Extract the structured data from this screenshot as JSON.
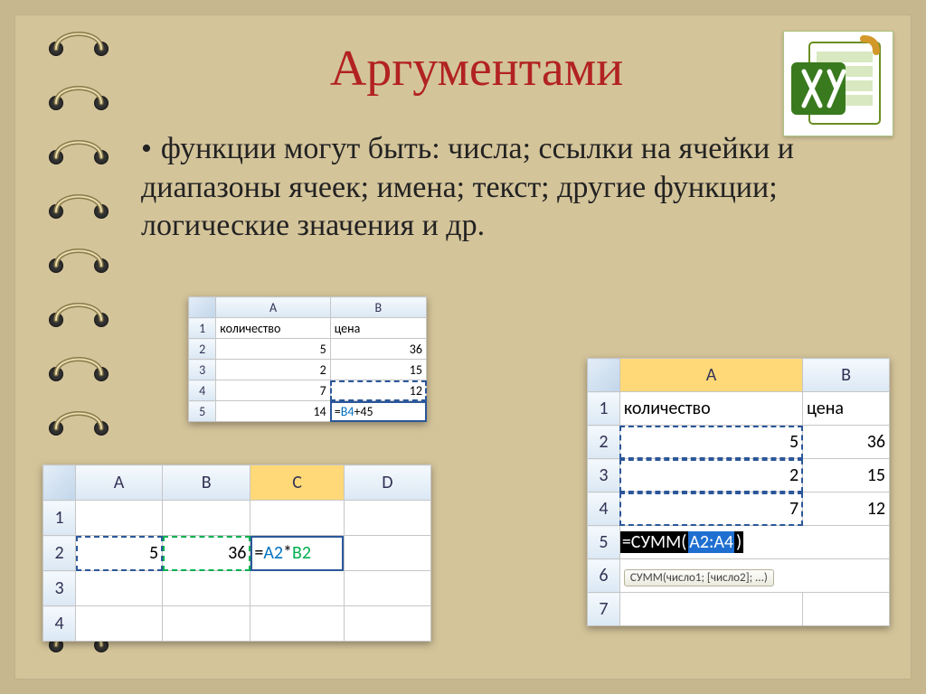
{
  "title": "Аргументами",
  "bullet_text": "функции могут быть: числа; ссылки на ячейки и диапазоны ячеек; имена; текст; другие функции; логические значения и др.",
  "icon_alt": "excel-icon",
  "shot1": {
    "cols": [
      "A",
      "B"
    ],
    "rows": [
      "1",
      "2",
      "3",
      "4",
      "5"
    ],
    "header": {
      "A": "количество",
      "B": "цена"
    },
    "data": {
      "A2": "5",
      "B2": "36",
      "A3": "2",
      "B3": "15",
      "A4": "7",
      "B4": "12",
      "A5": "14"
    },
    "formula": {
      "eq": "=",
      "ref": "B4",
      "rest": "+45"
    }
  },
  "shot2": {
    "cols": [
      "A",
      "B",
      "C",
      "D"
    ],
    "rows": [
      "1",
      "2",
      "3",
      "4"
    ],
    "data": {
      "A2": "5",
      "B2": "36"
    },
    "formula": {
      "eq": "=",
      "ref1": "A2",
      "op": "*",
      "ref2": "B2"
    }
  },
  "shot3": {
    "cols": [
      "A",
      "B"
    ],
    "rows": [
      "1",
      "2",
      "3",
      "4",
      "5",
      "6",
      "7"
    ],
    "header": {
      "A": "количество",
      "B": "цена"
    },
    "data": {
      "A2": "5",
      "B2": "36",
      "A3": "2",
      "B3": "15",
      "A4": "7",
      "B4": "12"
    },
    "formula_prefix": "=СУММ(",
    "formula_range": "A2:A4",
    "formula_suffix": ")",
    "tooltip": "СУММ(число1; [число2]; ...)"
  }
}
